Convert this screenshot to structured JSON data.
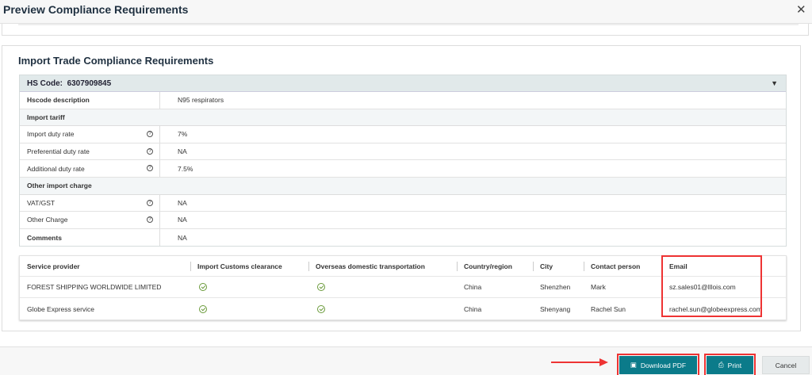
{
  "dialog": {
    "title": "Preview Compliance Requirements",
    "close": "✕"
  },
  "section_title": "Import Trade Compliance Requirements",
  "hs": {
    "label": "HS Code:",
    "code": "6307909845",
    "description_label": "Hscode description",
    "description": "N95 respirators",
    "import_tariff": "Import tariff",
    "tariff_rows": [
      {
        "label": "Import duty rate",
        "value": "7%"
      },
      {
        "label": "Preferential duty rate",
        "value": "NA"
      },
      {
        "label": "Additional duty rate",
        "value": "7.5%"
      }
    ],
    "other_charge": "Other import charge",
    "charge_rows": [
      {
        "label": "VAT/GST",
        "value": "NA"
      },
      {
        "label": "Other Charge",
        "value": "NA"
      }
    ],
    "comments_label": "Comments",
    "comments": "NA"
  },
  "providers": {
    "headers": [
      "Service provider",
      "Import Customs clearance",
      "Overseas domestic transportation",
      "Country/region",
      "City",
      "Contact person",
      "Email"
    ],
    "rows": [
      {
        "name": "FOREST SHIPPING WORLDWIDE LIMITED",
        "country": "China",
        "city": "Shenzhen",
        "contact": "Mark",
        "email": "sz.sales01@lllois.com"
      },
      {
        "name": "Globe Express service",
        "country": "China",
        "city": "Shenyang",
        "contact": "Rachel Sun",
        "email": "rachel.sun@globeexpress.com"
      }
    ]
  },
  "footer": {
    "download": "Download PDF",
    "print": "Print",
    "cancel": "Cancel"
  },
  "colors": {
    "accent": "#0b7b8a",
    "highlight": "#ee3333",
    "check": "#6a9a3a"
  }
}
